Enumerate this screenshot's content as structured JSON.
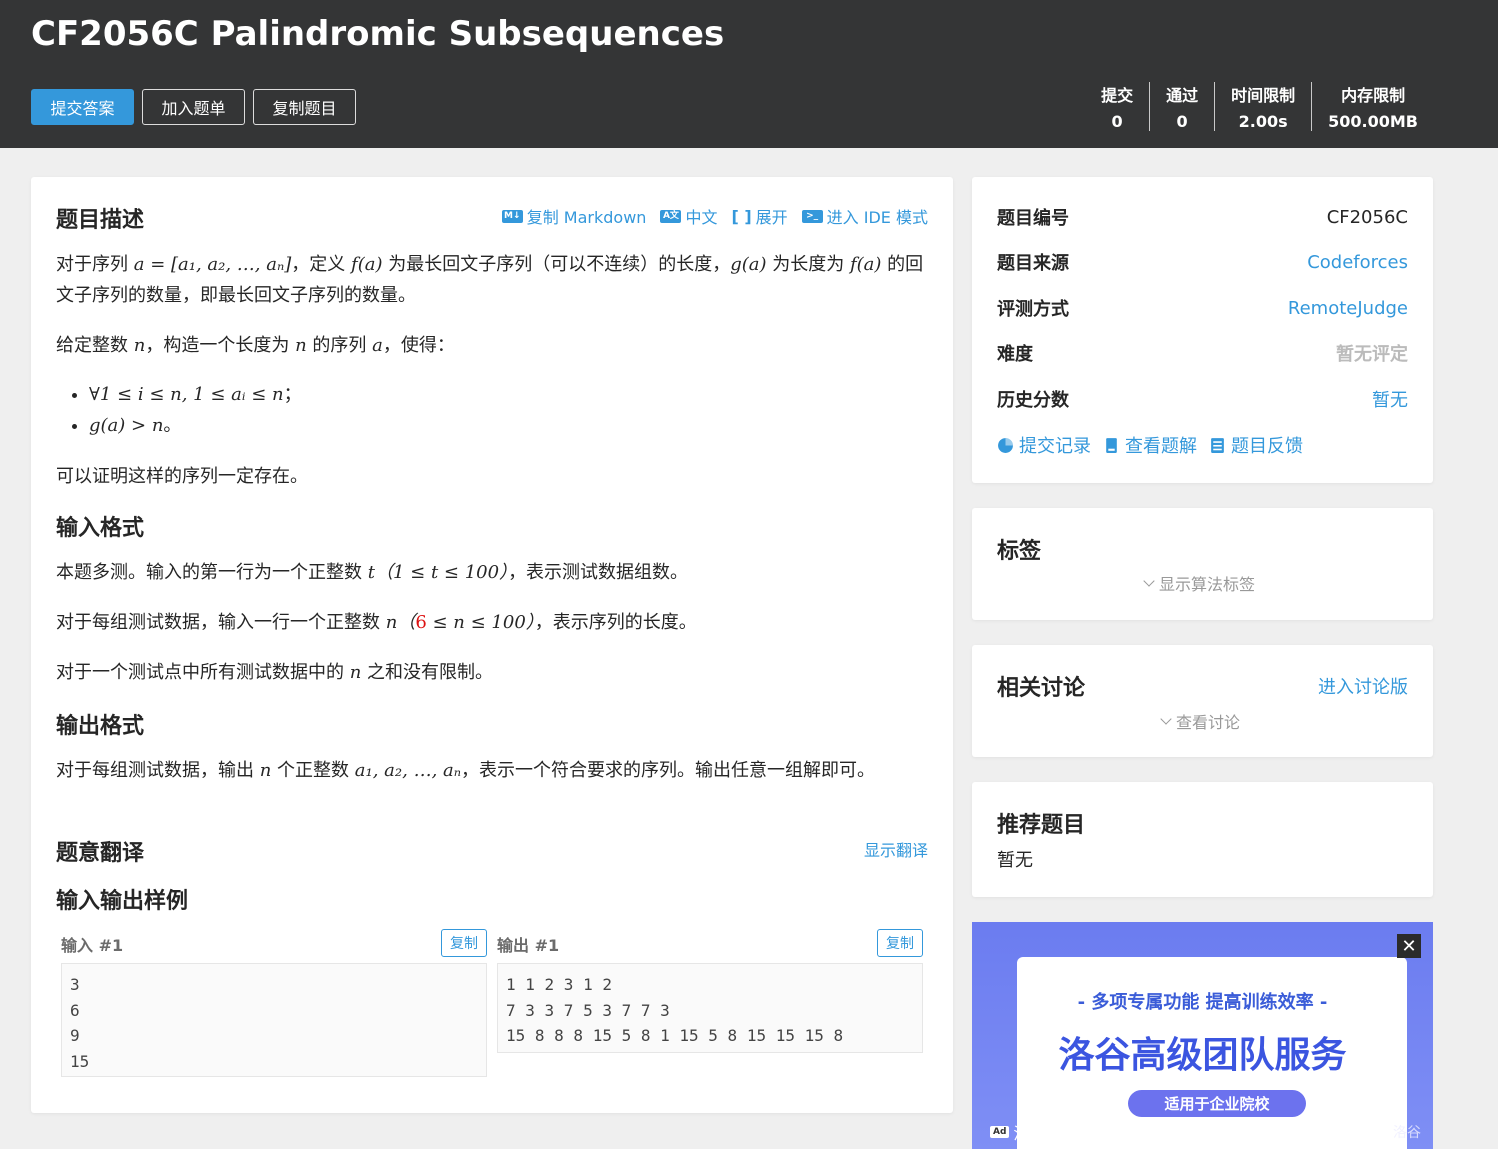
{
  "header": {
    "title": "CF2056C Palindromic Subsequences",
    "buttons": {
      "submit": "提交答案",
      "add_list": "加入题单",
      "copy_problem": "复制题目"
    },
    "stats": [
      {
        "label": "提交",
        "value": "0"
      },
      {
        "label": "通过",
        "value": "0"
      },
      {
        "label": "时间限制",
        "value": "2.00s"
      },
      {
        "label": "内存限制",
        "value": "500.00MB"
      }
    ]
  },
  "problem": {
    "toolbar": {
      "copy_md": "复制 Markdown",
      "lang": "中文",
      "expand": "展开",
      "ide": "进入 IDE 模式"
    },
    "desc_title": "题目描述",
    "desc_p1_a": "对于序列 ",
    "desc_p1_b": "，定义 ",
    "desc_p1_c": " 为最长回文子序列（可以不连续）的长度，",
    "desc_p1_d": " 为长度为 ",
    "desc_p1_e": " 的回文子序列的数量，即最长回文子序列的数量。",
    "desc_p2_a": "给定整数 ",
    "desc_p2_b": "，构造一个长度为 ",
    "desc_p2_c": " 的序列 ",
    "desc_p2_d": "，使得：",
    "cond1_end": "；",
    "cond2_end": "。",
    "desc_p3": "可以证明这样的序列一定存在。",
    "input_title": "输入格式",
    "in_p1_a": "本题多测。输入的第一行为一个正整数 ",
    "in_p1_b": "，表示测试数据组数。",
    "in_p2_a": "对于每组测试数据，输入一行一个正整数 ",
    "in_p2_b": "，表示序列的长度。",
    "in_p3_a": "对于一个测试点中所有测试数据中的 ",
    "in_p3_b": " 之和没有限制。",
    "output_title": "输出格式",
    "out_p1_a": "对于每组测试数据，输出 ",
    "out_p1_b": " 个正整数 ",
    "out_p1_c": "，表示一个符合要求的序列。输出任意一组解即可。",
    "translation_title": "题意翻译",
    "show_translation": "显示翻译",
    "samples_title": "输入输出样例",
    "input_label": "输入 #1",
    "output_label": "输出 #1",
    "copy": "复制",
    "sample_input": "3\n6\n9\n15",
    "sample_output": "1 1 2 3 1 2\n7 3 3 7 5 3 7 7 3\n15 8 8 8 15 5 8 1 15 5 8 15 15 15 8"
  },
  "info": {
    "rows": [
      {
        "k": "题目编号",
        "v": "CF2056C"
      },
      {
        "k": "题目来源",
        "v": "Codeforces"
      },
      {
        "k": "评测方式",
        "v": "RemoteJudge"
      },
      {
        "k": "难度",
        "v": "暂无评定"
      },
      {
        "k": "历史分数",
        "v": "暂无"
      }
    ],
    "actions": {
      "records": "提交记录",
      "solutions": "查看题解",
      "feedback": "题目反馈"
    }
  },
  "tags": {
    "title": "标签",
    "toggle": "显示算法标签"
  },
  "discuss": {
    "title": "相关讨论",
    "enter": "进入讨论版",
    "toggle": "查看讨论"
  },
  "recommend": {
    "title": "推荐题目",
    "value": "暂无"
  },
  "ad": {
    "sub": "- 多项专属功能 提高训练效率 -",
    "headline": "洛谷高级团队服务",
    "pill": "适用于企业院校",
    "ad_badge": "Ad",
    "label": "洛谷广告",
    "brand": "洛谷",
    "close": "✕"
  },
  "colors": {
    "accent": "#3498db",
    "header_bg": "#343536",
    "page_bg": "#efefef"
  }
}
